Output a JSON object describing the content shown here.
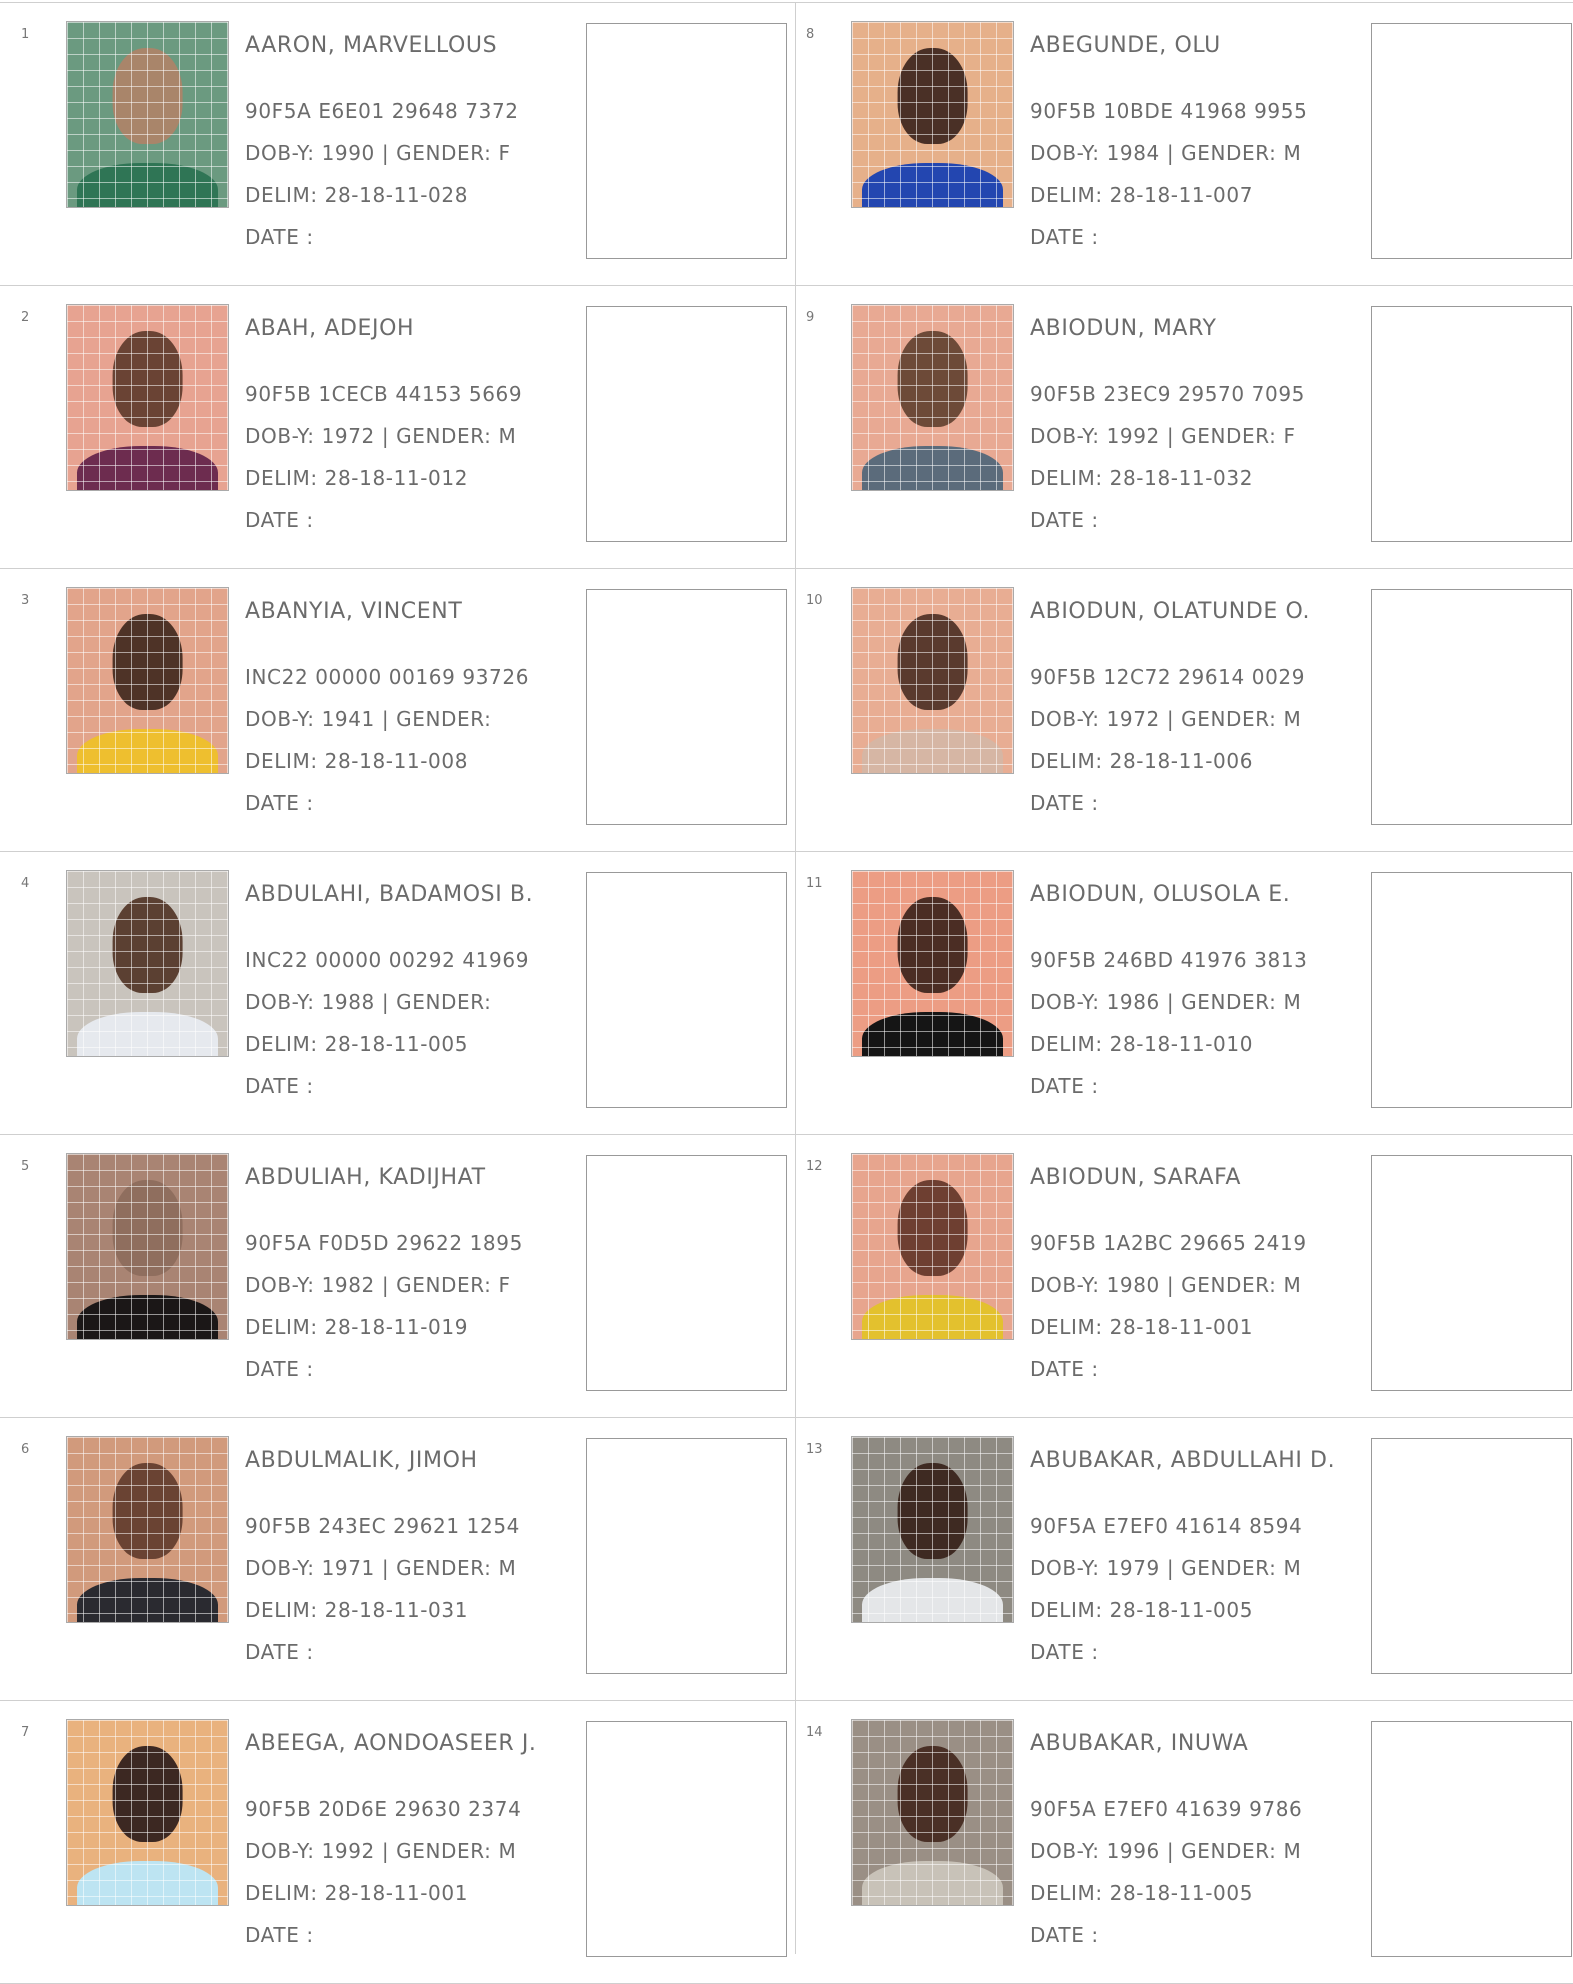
{
  "labels": {
    "dob": "DOB-Y:",
    "gender": "| GENDER:",
    "delim": "DELIM:",
    "date": "DATE :"
  },
  "voters": [
    {
      "num": "1",
      "name": "AARON, MARVELLOUS",
      "vin": "90F5A E6E01 29648 7372",
      "dob": "1990",
      "gender": "F",
      "delim": "28-18-11-028",
      "photo": {
        "bg": "#6b9a80",
        "skin": "#a9856a",
        "cloth": "#2f7555"
      }
    },
    {
      "num": "2",
      "name": "ABAH, ADEJOH",
      "vin": "90F5B 1CECB 44153 5669",
      "dob": "1972",
      "gender": "M",
      "delim": "28-18-11-012",
      "photo": {
        "bg": "#e7a391",
        "skin": "#6a4334",
        "cloth": "#6d2c4f"
      }
    },
    {
      "num": "3",
      "name": "ABANYIA, VINCENT",
      "vin": "INC22 00000 00169 93726",
      "dob": "1941",
      "gender": "",
      "delim": "28-18-11-008",
      "photo": {
        "bg": "#e2a48b",
        "skin": "#4e3327",
        "cloth": "#eebf2f"
      }
    },
    {
      "num": "4",
      "name": "ABDULAHI, BADAMOSI B.",
      "vin": "INC22 00000 00292 41969",
      "dob": "1988",
      "gender": "",
      "delim": "28-18-11-005",
      "photo": {
        "bg": "#c9c4bd",
        "skin": "#5b4032",
        "cloth": "#e6e9ee"
      }
    },
    {
      "num": "5",
      "name": "ABDULIAH, KADIJHAT",
      "vin": "90F5A F0D5D 29622 1895",
      "dob": "1982",
      "gender": "F",
      "delim": "28-18-11-019",
      "photo": {
        "bg": "#a98473",
        "skin": "#8f6e5e",
        "cloth": "#1b1717"
      }
    },
    {
      "num": "6",
      "name": "ABDULMALIK, JIMOH",
      "vin": "90F5B 243EC 29621 1254",
      "dob": "1971",
      "gender": "M",
      "delim": "28-18-11-031",
      "photo": {
        "bg": "#d19a7c",
        "skin": "#6a4333",
        "cloth": "#2a2a30"
      }
    },
    {
      "num": "7",
      "name": "ABEEGA, AONDOASEER J.",
      "vin": "90F5B 20D6E 29630 2374",
      "dob": "1992",
      "gender": "M",
      "delim": "28-18-11-001",
      "photo": {
        "bg": "#e9b27e",
        "skin": "#3c2822",
        "cloth": "#bde4f2"
      }
    },
    {
      "num": "8",
      "name": "ABEGUNDE, OLU",
      "vin": "90F5B 10BDE 41968 9955",
      "dob": "1984",
      "gender": "M",
      "delim": "28-18-11-007",
      "photo": {
        "bg": "#e6b08a",
        "skin": "#4a3026",
        "cloth": "#2346b0"
      }
    },
    {
      "num": "9",
      "name": "ABIODUN, MARY",
      "vin": "90F5B 23EC9 29570 7095",
      "dob": "1992",
      "gender": "F",
      "delim": "28-18-11-032",
      "photo": {
        "bg": "#e8a993",
        "skin": "#6d4a38",
        "cloth": "#5b6b7b"
      }
    },
    {
      "num": "10",
      "name": "ABIODUN, OLATUNDE O.",
      "vin": "90F5B 12C72 29614 0029",
      "dob": "1972",
      "gender": "M",
      "delim": "28-18-11-006",
      "photo": {
        "bg": "#e8ad93",
        "skin": "#5a3a2e",
        "cloth": "#d6b6a4"
      }
    },
    {
      "num": "11",
      "name": "ABIODUN, OLUSOLA E.",
      "vin": "90F5B 246BD 41976 3813",
      "dob": "1986",
      "gender": "M",
      "delim": "28-18-11-010",
      "photo": {
        "bg": "#ec9d84",
        "skin": "#4b2d24",
        "cloth": "#151515"
      }
    },
    {
      "num": "12",
      "name": "ABIODUN, SARAFA",
      "vin": "90F5B 1A2BC 29665 2419",
      "dob": "1980",
      "gender": "M",
      "delim": "28-18-11-001",
      "photo": {
        "bg": "#e7a58e",
        "skin": "#6e3f31",
        "cloth": "#e3c12e"
      }
    },
    {
      "num": "13",
      "name": "ABUBAKAR, ABDULLAHI D.",
      "vin": "90F5A E7EF0 41614 8594",
      "dob": "1979",
      "gender": "M",
      "delim": "28-18-11-005",
      "photo": {
        "bg": "#8e8a82",
        "skin": "#3e2a22",
        "cloth": "#e4e6e8"
      }
    },
    {
      "num": "14",
      "name": "ABUBAKAR, INUWA",
      "vin": "90F5A E7EF0 41639 9786",
      "dob": "1996",
      "gender": "M",
      "delim": "28-18-11-005",
      "photo": {
        "bg": "#9a8f85",
        "skin": "#4a3026",
        "cloth": "#c8c2b8"
      }
    }
  ]
}
